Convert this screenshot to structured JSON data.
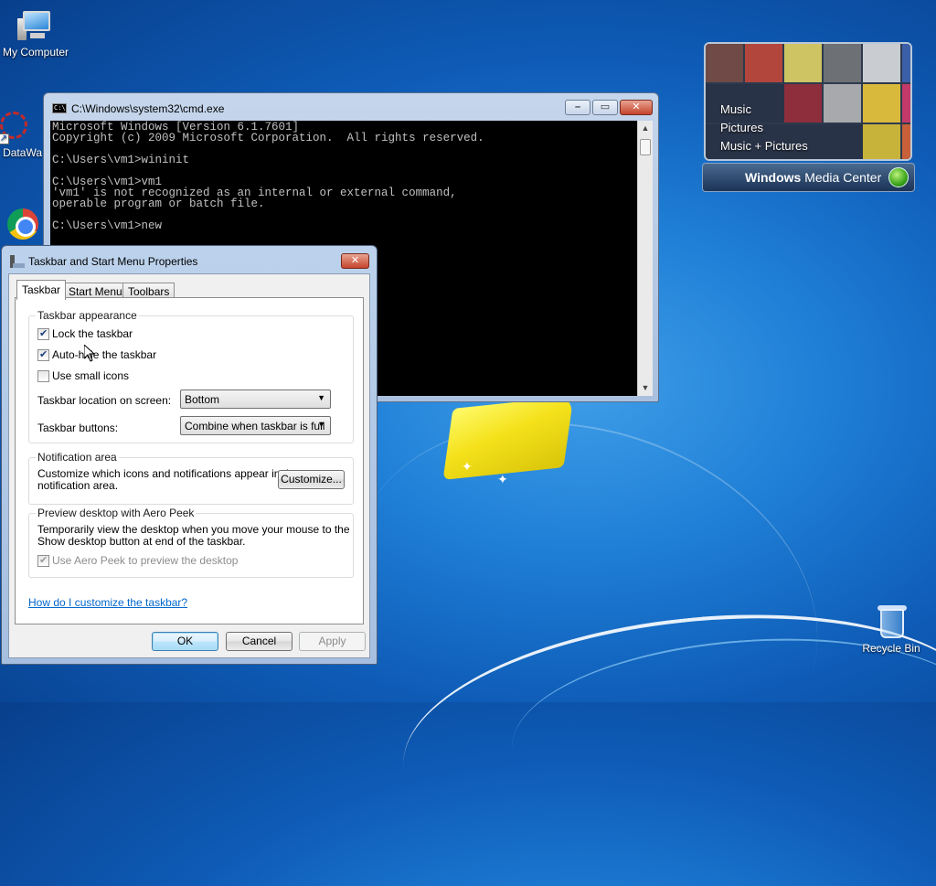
{
  "desktop": {
    "icons": {
      "my_computer": "My Computer",
      "datawatch": "DataWa",
      "recycle_bin": "Recycle Bin"
    }
  },
  "wmc_gadget": {
    "menu": [
      "Music",
      "Pictures",
      "Music + Pictures"
    ],
    "brand_bold": "Windows",
    "brand_rest": " Media Center"
  },
  "cmd": {
    "title": "C:\\Windows\\system32\\cmd.exe",
    "icon_text": "C:\\",
    "lines": [
      "Microsoft Windows [Version 6.1.7601]",
      "Copyright (c) 2009 Microsoft Corporation.  All rights reserved.",
      "",
      "C:\\Users\\vm1>wininit",
      "",
      "C:\\Users\\vm1>vm1",
      "'vm1' is not recognized as an internal or external command,",
      "operable program or batch file.",
      "",
      "C:\\Users\\vm1>new"
    ]
  },
  "dialog": {
    "title": "Taskbar and Start Menu Properties",
    "tabs": [
      "Taskbar",
      "Start Menu",
      "Toolbars"
    ],
    "appearance": {
      "legend": "Taskbar appearance",
      "lock": {
        "label": "Lock the taskbar",
        "checked": true
      },
      "autohide": {
        "label": "Auto-hide the taskbar",
        "checked": true
      },
      "small_icons": {
        "label": "Use small icons",
        "checked": false
      },
      "location_label": "Taskbar location on screen:",
      "location_value": "Bottom",
      "buttons_label": "Taskbar buttons:",
      "buttons_value": "Combine when taskbar is full"
    },
    "notification": {
      "legend": "Notification area",
      "text_line1": "Customize which icons and notifications appear in the",
      "text_line2": "notification area.",
      "customize_button": "Customize..."
    },
    "aero_peek": {
      "legend": "Preview desktop with Aero Peek",
      "text_line1": "Temporarily view the desktop when you move your mouse to the",
      "text_line2": "Show desktop button at end of the taskbar.",
      "checkbox": {
        "label": "Use Aero Peek to preview the desktop",
        "checked": true,
        "disabled": true
      }
    },
    "help_link": "How do I customize the taskbar?",
    "buttons": {
      "ok": "OK",
      "cancel": "Cancel",
      "apply": "Apply"
    }
  },
  "colors": {
    "desktop_blue": "#1f7fd6",
    "console_bg": "#000000",
    "console_fg": "#c0c0c0",
    "link": "#0066cc"
  }
}
